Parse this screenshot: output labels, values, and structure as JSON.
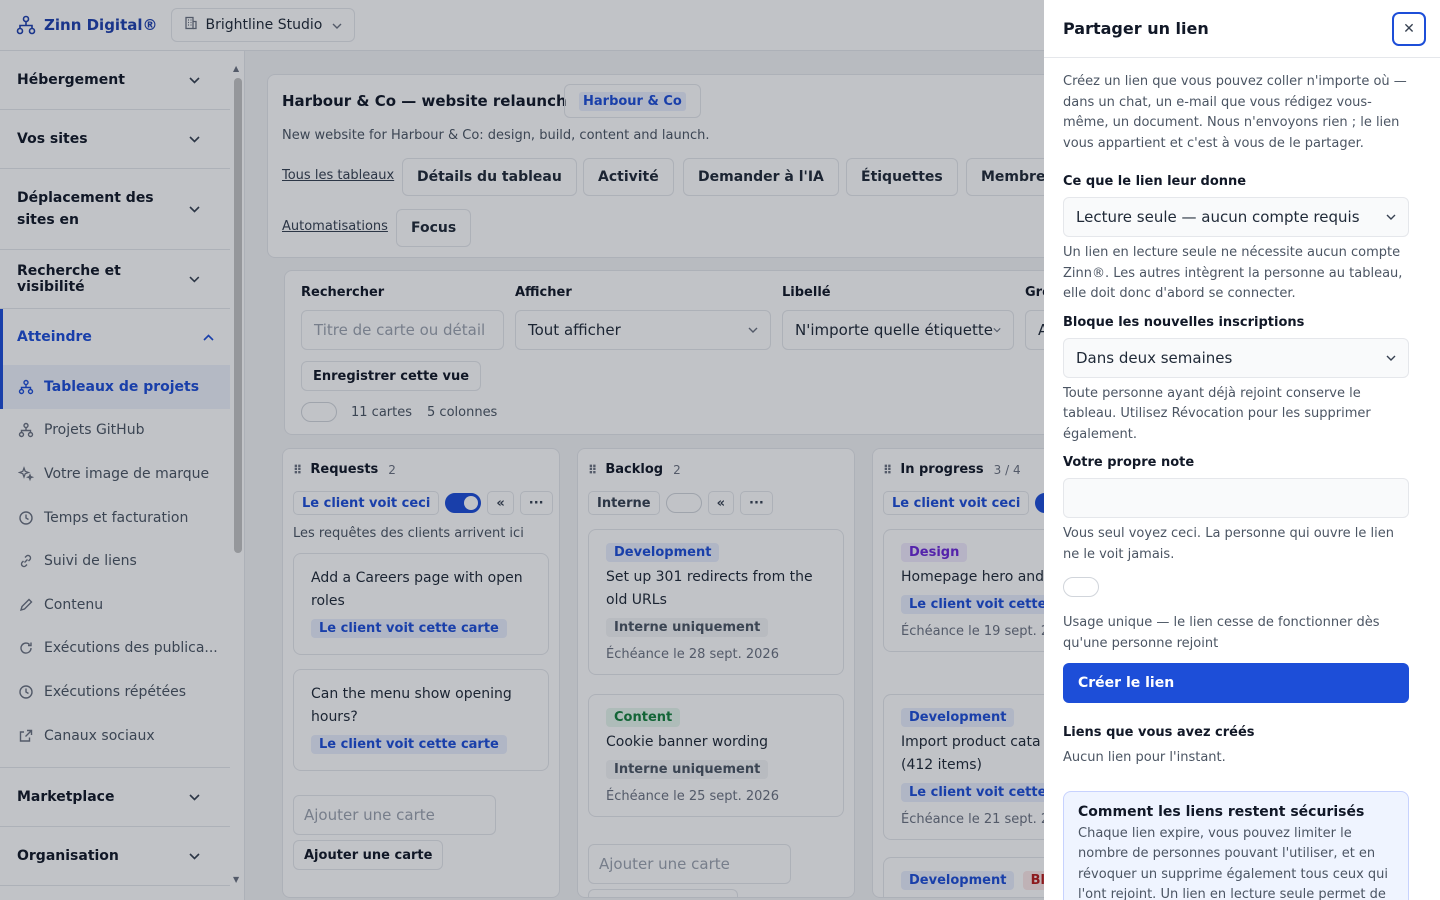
{
  "app": {
    "brand": "Zinn Digital®",
    "workspace": "Brightline Studio"
  },
  "sidebar": {
    "sections_top": [
      {
        "label": "Hébergement"
      },
      {
        "label": "Vos sites"
      },
      {
        "label": "Déplacement des sites en"
      },
      {
        "label": "Recherche et visibilité"
      }
    ],
    "active_section": "Atteindre",
    "items": [
      {
        "label": "Tableaux de projets",
        "icon": "project-boards-icon"
      },
      {
        "label": "Projets GitHub",
        "icon": "github-projects-icon"
      },
      {
        "label": "Votre image de marque",
        "icon": "sparkle-icon"
      },
      {
        "label": "Temps et facturation",
        "icon": "clock-icon"
      },
      {
        "label": "Suivi de liens",
        "icon": "link-icon"
      },
      {
        "label": "Contenu",
        "icon": "pencil-icon"
      },
      {
        "label": "Exécutions des publica...",
        "icon": "refresh-icon"
      },
      {
        "label": "Exécutions répétées",
        "icon": "clock-icon"
      },
      {
        "label": "Canaux sociaux",
        "icon": "external-link-icon"
      }
    ],
    "sections_bottom": [
      {
        "label": "Marketplace"
      },
      {
        "label": "Organisation"
      }
    ]
  },
  "board": {
    "title": "Harbour & Co — website relaunch",
    "client": "Harbour & Co",
    "description": "New website for Harbour & Co: design, build, content and launch.",
    "all_boards": "Tous les tableaux",
    "tabs": [
      "Détails du tableau",
      "Activité",
      "Demander à l'IA",
      "Étiquettes",
      "Membres"
    ],
    "automations": "Automatisations",
    "focus": "Focus"
  },
  "filters": {
    "search_label": "Rechercher",
    "search_placeholder": "Titre de carte ou détail",
    "show_label": "Afficher",
    "show_value": "Tout afficher",
    "tag_label": "Libellé",
    "tag_value": "N'importe quelle étiquette",
    "group_label": "Gro",
    "group_value": "A",
    "save_view": "Enregistrer cette vue",
    "cards_count": "11 cartes",
    "columns_count": "5 colonnes"
  },
  "columns": [
    {
      "name": "Requests",
      "count": "2",
      "visibility": "Le client voit ceci",
      "visible": true,
      "description": "Les requêtes des clients arrivent ici",
      "cards": [
        {
          "title": "Add a Careers page with open roles",
          "badge": "Le client voit cette carte"
        },
        {
          "title": "Can the menu show opening hours?",
          "badge": "Le client voit cette carte"
        }
      ],
      "add_placeholder": "Ajouter une carte",
      "add_button": "Ajouter une carte"
    },
    {
      "name": "Backlog",
      "count": "2",
      "visibility": "Interne",
      "visible": false,
      "cards": [
        {
          "tag": "Development",
          "title": "Set up 301 redirects from the old URLs",
          "badge": "Interne uniquement",
          "due": "Échéance le 28 sept. 2026"
        },
        {
          "tag": "Content",
          "title": "Cookie banner wording",
          "badge": "Interne uniquement",
          "due": "Échéance le 25 sept. 2026"
        }
      ],
      "add_placeholder": "Ajouter une carte",
      "add_button": "Ajouter une carte"
    },
    {
      "name": "In progress",
      "count": "3 / 4",
      "visibility": "Le client voit ceci",
      "visible": true,
      "cards": [
        {
          "tag": "Design",
          "title": "Homepage hero and navigation",
          "badge": "Le client voit cette",
          "due": "Échéance le 19 sept. 2"
        },
        {
          "tag": "Development",
          "title": "Import product cata (412 items)",
          "badge": "Le client voit cette",
          "due": "Échéance le 21 sept. 2"
        },
        {
          "tag": "Development",
          "tag2": "Blo"
        }
      ]
    }
  ],
  "share_panel": {
    "title": "Partager un lien",
    "intro": "Créez un lien que vous pouvez coller n'importe où — dans un chat, un e-mail que vous rédigez vous-même, un document. Nous n'envoyons rien ; le lien vous appartient et c'est à vous de le partager.",
    "access_label": "Ce que le lien leur donne",
    "access_value": "Lecture seule — aucun compte requis",
    "access_help": "Un lien en lecture seule ne nécessite aucun compte Zinn®. Les autres intègrent la personne au tableau, elle doit donc d'abord se connecter.",
    "expiry_label": "Bloque les nouvelles inscriptions",
    "expiry_value": "Dans deux semaines",
    "expiry_help": "Toute personne ayant déjà rejoint conserve le tableau. Utilisez Révocation pour les supprimer également.",
    "note_label": "Votre propre note",
    "note_value": "",
    "note_help": "Vous seul voyez ceci. La personne qui ouvre le lien ne le voit jamais.",
    "single_use_label": "Usage unique — le lien cesse de fonctionner dès qu'une personne rejoint",
    "single_use_on": false,
    "create_button": "Créer le lien",
    "created_label": "Liens que vous avez créés",
    "created_empty": "Aucun lien pour l'instant.",
    "info_title": "Comment les liens restent sécurisés",
    "info_text": "Chaque lien expire, vous pouvez limiter le nombre de personnes pouvant l'utiliser, et en révoquer un supprime également tous ceux qui l'ont rejoint. Un lien en lecture seule permet de"
  },
  "colors": {
    "accent": "#1d4ed8",
    "overlay": "#111827"
  }
}
